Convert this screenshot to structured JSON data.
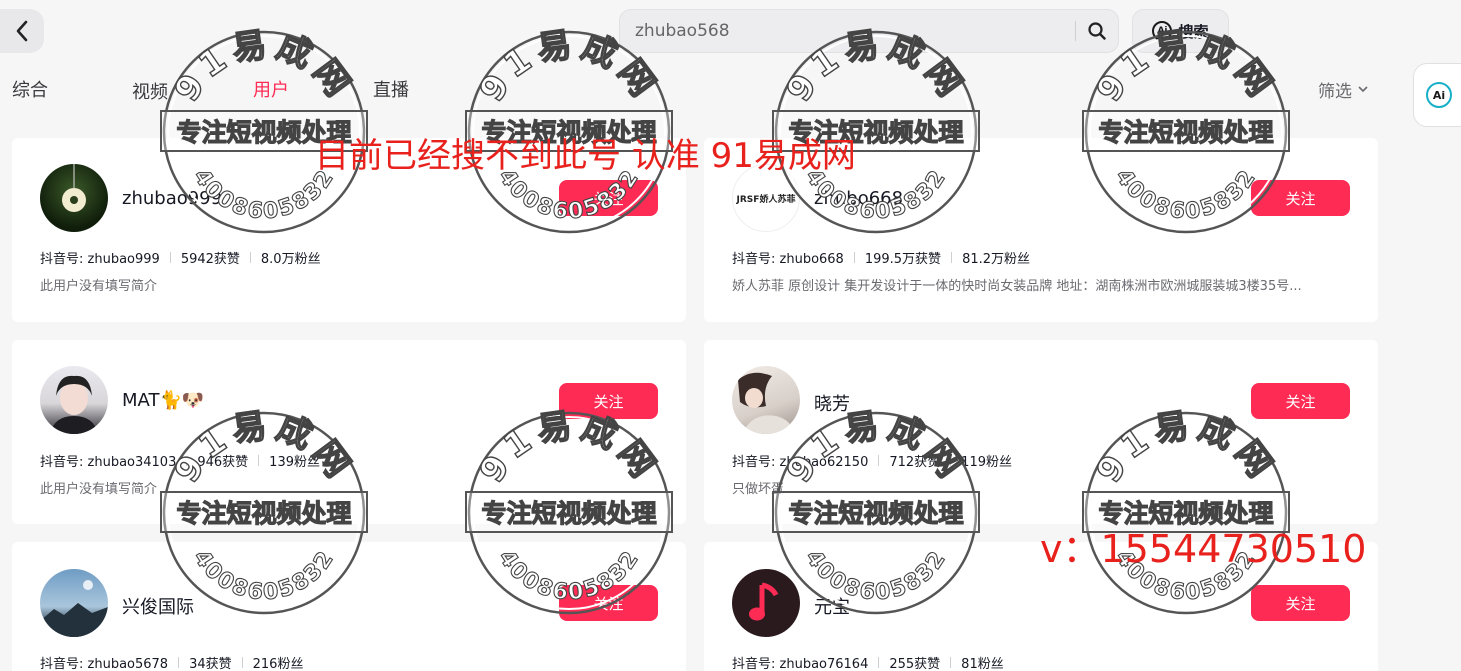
{
  "search": {
    "value": "zhubao568",
    "ai_label": "搜索",
    "ai_badge": "Ai"
  },
  "tabs": [
    {
      "label": "综合"
    },
    {
      "label": "视频"
    },
    {
      "label": "用户"
    },
    {
      "label": "直播"
    }
  ],
  "filter_label": "筛选",
  "follow_label": "关注",
  "users": [
    {
      "name": "zhubao999",
      "id_text": "抖音号: zhubao999",
      "likes": "5942获赞",
      "fans": "8.0万粉丝",
      "bio": "此用户没有填写简介"
    },
    {
      "name": "zhubo668",
      "id_text": "抖音号: zhubo668",
      "likes": "199.5万获赞",
      "fans": "81.2万粉丝",
      "bio": "娇人苏菲 原创设计 集开发设计于一体的快时尚女装品牌 地址：湖南株洲市欧洲城服装城3楼35号...",
      "avatar_text": "JRSF娇人苏菲"
    },
    {
      "name": "MAT🐈🐶",
      "id_text": "抖音号: zhubao34103",
      "likes": "946获赞",
      "fans": "139粉丝",
      "bio": "此用户没有填写简介"
    },
    {
      "name": "晓芳",
      "id_text": "抖音号: zhubao62150",
      "likes": "712获赞",
      "fans": "119粉丝",
      "bio": "只做坏蛋"
    },
    {
      "name": "兴俊国际",
      "id_text": "抖音号: zhubao5678",
      "likes": "34获赞",
      "fans": "216粉丝",
      "bio": ""
    },
    {
      "name": "元宝",
      "id_text": "抖音号: zhubao76164",
      "likes": "255获赞",
      "fans": "81粉丝",
      "bio": ""
    }
  ],
  "watermark": {
    "stamp_top": "91易成网",
    "stamp_middle": "专注短视频处理",
    "stamp_bottom": "4008605832",
    "notice": "目前已经搜不到此号   认准   91易成网",
    "contact": "v：15544730510",
    "color": "#e8211d"
  }
}
